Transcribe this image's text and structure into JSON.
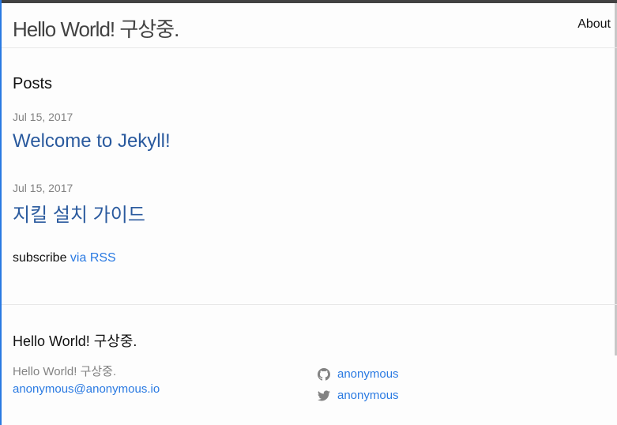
{
  "header": {
    "site_title": "Hello World! 구상중.",
    "nav": [
      {
        "label": "About"
      }
    ]
  },
  "main": {
    "heading": "Posts",
    "posts": [
      {
        "date": "Jul 15, 2017",
        "title": "Welcome to Jekyll!"
      },
      {
        "date": "Jul 15, 2017",
        "title": "지킬 설치 가이드"
      }
    ],
    "subscribe_text": "subscribe ",
    "subscribe_link": "via RSS"
  },
  "footer": {
    "heading": "Hello World! 구상중.",
    "name": "Hello World! 구상중.",
    "email": "anonymous@anonymous.io",
    "social": [
      {
        "icon": "github-icon",
        "label": "anonymous"
      },
      {
        "icon": "twitter-icon",
        "label": "anonymous"
      }
    ]
  },
  "colors": {
    "link": "#2a7ae2",
    "meta": "#828282",
    "border": "#e8e8e8",
    "top_bar": "#424242"
  }
}
